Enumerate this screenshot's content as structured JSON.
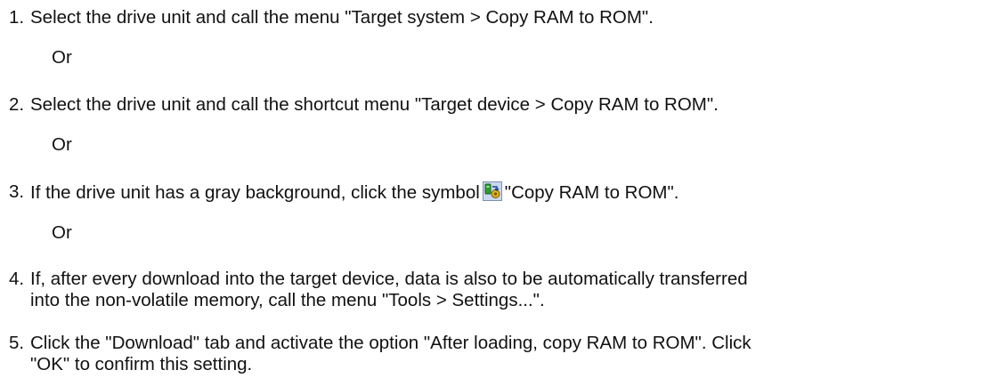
{
  "steps": [
    {
      "number": "1.",
      "text": "Select the drive unit and call the menu \"Target system > Copy RAM to ROM\"."
    },
    {
      "number": "2.",
      "text": "Select the drive unit and call the shortcut menu \"Target device > Copy RAM to ROM\"."
    },
    {
      "number": "3.",
      "text_before": "If the drive unit has a gray background, click the symbol",
      "text_after": "\"Copy RAM to ROM\".",
      "icon": "copy-ram-to-rom-icon"
    },
    {
      "number": "4.",
      "line1": "If, after every download into the target device, data is also to be automatically transferred",
      "line2": "into the non-volatile memory, call the menu \"Tools > Settings...\"."
    },
    {
      "number": "5.",
      "line1": "Click the \"Download\" tab and activate the option \"After loading, copy RAM to ROM\". Click",
      "line2": "\"OK\" to confirm this setting."
    }
  ],
  "or_label": "Or",
  "colors": {
    "icon_green": "#2e9e2e",
    "icon_bg": "#c9d8f0",
    "icon_yellow": "#e0b020"
  }
}
